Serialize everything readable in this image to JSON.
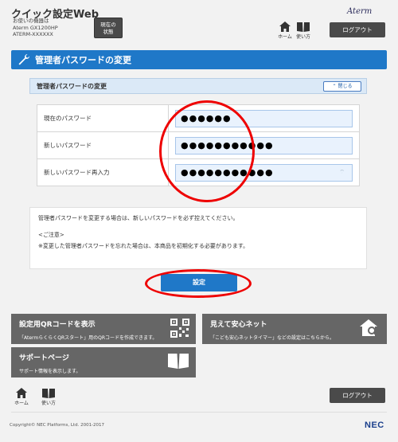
{
  "header": {
    "title": "クイック設定Web",
    "device_lines": [
      "お使いの機器は",
      "Aterm GX1200HP",
      "ATERM-XXXXXX"
    ],
    "status_button": [
      "現在の",
      "状態"
    ],
    "brand": "Aterm",
    "nav": {
      "home": "ホーム",
      "manual": "使い方"
    },
    "logout": "ログアウト"
  },
  "section": {
    "title": "管理者パスワードの変更",
    "icon": "wrench-icon"
  },
  "panel": {
    "title": "管理者パスワードの変更",
    "collapse": "閉じる"
  },
  "form": {
    "rows": [
      {
        "label": "現在のパスワード",
        "value": "●●●●●●"
      },
      {
        "label": "新しいパスワード",
        "value": "●●●●●●●●●●●"
      },
      {
        "label": "新しいパスワード再入力",
        "value": "●●●●●●●●●●●"
      }
    ]
  },
  "notice": {
    "line1": "管理者パスワードを変更する場合は、新しいパスワードを必ず控えてください。",
    "line2": "<ご注意>",
    "line3": "※変更した管理者パスワードを忘れた場合は、本商品を初期化する必要があります。"
  },
  "set_button": "設定",
  "tiles": {
    "qr": {
      "title": "設定用QRコードを表示",
      "desc": "「AtermらくらくQRスタート」用のQRコードを作成できます。"
    },
    "safe_net": {
      "title": "見えて安心ネット",
      "desc": "「こども安心ネットタイマー」などの設定はこちらから。"
    },
    "support": {
      "title": "サポートページ",
      "desc": "サポート情報を表示します。"
    }
  },
  "footer": {
    "nav": {
      "home": "ホーム",
      "manual": "使い方"
    },
    "logout": "ログアウト",
    "copyright": "Copyright© NEC Platforms, Ltd. 2001-2017",
    "brand": "NEC"
  },
  "colors": {
    "accent": "#1f78c8",
    "annotation": "#e00000",
    "tile": "#666666"
  }
}
